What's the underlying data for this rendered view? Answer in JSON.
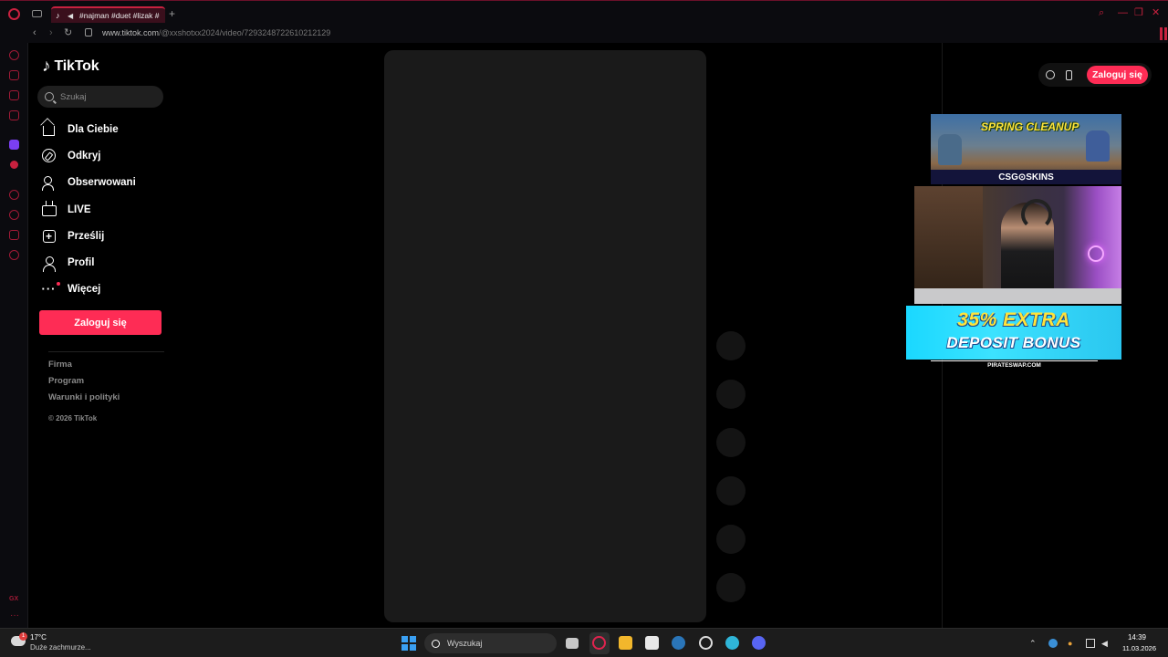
{
  "browser": {
    "tab_title": "#najman #duet #lizak #",
    "new_tab": "+",
    "url_host": "www.tiktok.com",
    "url_path": "/@xxshotxx2024/video/7293248722610212129",
    "back": "‹",
    "forward": "›",
    "reload": "↻",
    "controls": [
      "⌕",
      "—",
      "❐",
      "✕"
    ]
  },
  "sidebar_panel": {
    "gx_label": "GX",
    "more": "···"
  },
  "tiktok": {
    "logo": "TikTok",
    "search_placeholder": "Szukaj",
    "nav": [
      {
        "label": "Dla Ciebie",
        "icon": "home-icon"
      },
      {
        "label": "Odkryj",
        "icon": "compass-icon"
      },
      {
        "label": "Obserwowani",
        "icon": "following-icon"
      },
      {
        "label": "LIVE",
        "icon": "live-icon"
      },
      {
        "label": "Prześlij",
        "icon": "upload-icon"
      },
      {
        "label": "Profil",
        "icon": "profile-icon"
      },
      {
        "label": "Więcej",
        "icon": "more-icon"
      }
    ],
    "login_label": "Zaloguj się",
    "footer": {
      "links": [
        "Firma",
        "Program",
        "Warunki i polityki"
      ],
      "copyright": "© 2026 TikTok"
    },
    "top_login_label": "Zaloguj się",
    "accent": "#fe2c55"
  },
  "overlay": {
    "ad_top_title": "SPRING CLEANUP",
    "ad_top_brand": "CSG⊙SKINS",
    "ad_bonus_line1": "35% EXTRA",
    "ad_bonus_line2": "DEPOSIT BONUS",
    "ad_bonus_source": "PIRATESWAP.COM"
  },
  "taskbar": {
    "weather_temp": "17°C",
    "weather_desc": "Duże zachmurze...",
    "weather_badge": "1",
    "search_placeholder": "Wyszukaj",
    "time": "14:39",
    "date": "11.03.2026"
  }
}
